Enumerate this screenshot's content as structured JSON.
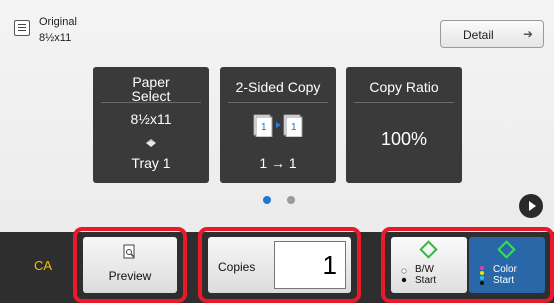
{
  "header": {
    "original_title": "Original",
    "original_size": "8½x11",
    "detail_label": "Detail"
  },
  "tiles": [
    {
      "title_line1": "Paper",
      "title_line2": "Select",
      "value1": "8½x11",
      "value2": "Tray 1"
    },
    {
      "title": "2-Sided Copy",
      "value": "1 → 1"
    },
    {
      "title": "Copy Ratio",
      "value": "100%"
    }
  ],
  "pager": {
    "pages": 2,
    "current": 1,
    "active_color": "#1e78d6",
    "inactive_color": "#9a9a9a"
  },
  "bottom": {
    "ca_label": "CA",
    "preview_label": "Preview",
    "copies_label": "Copies",
    "copies_value": "1",
    "bw_label_line1": "B/W",
    "bw_label_line2": "Start",
    "color_label_line1": "Color",
    "color_label_line2": "Start"
  },
  "colors": {
    "highlight": "#e81a2c",
    "start_green": "#3cb34a",
    "color_start_bg": "#2a67a8",
    "ca_text": "#f0c000"
  }
}
